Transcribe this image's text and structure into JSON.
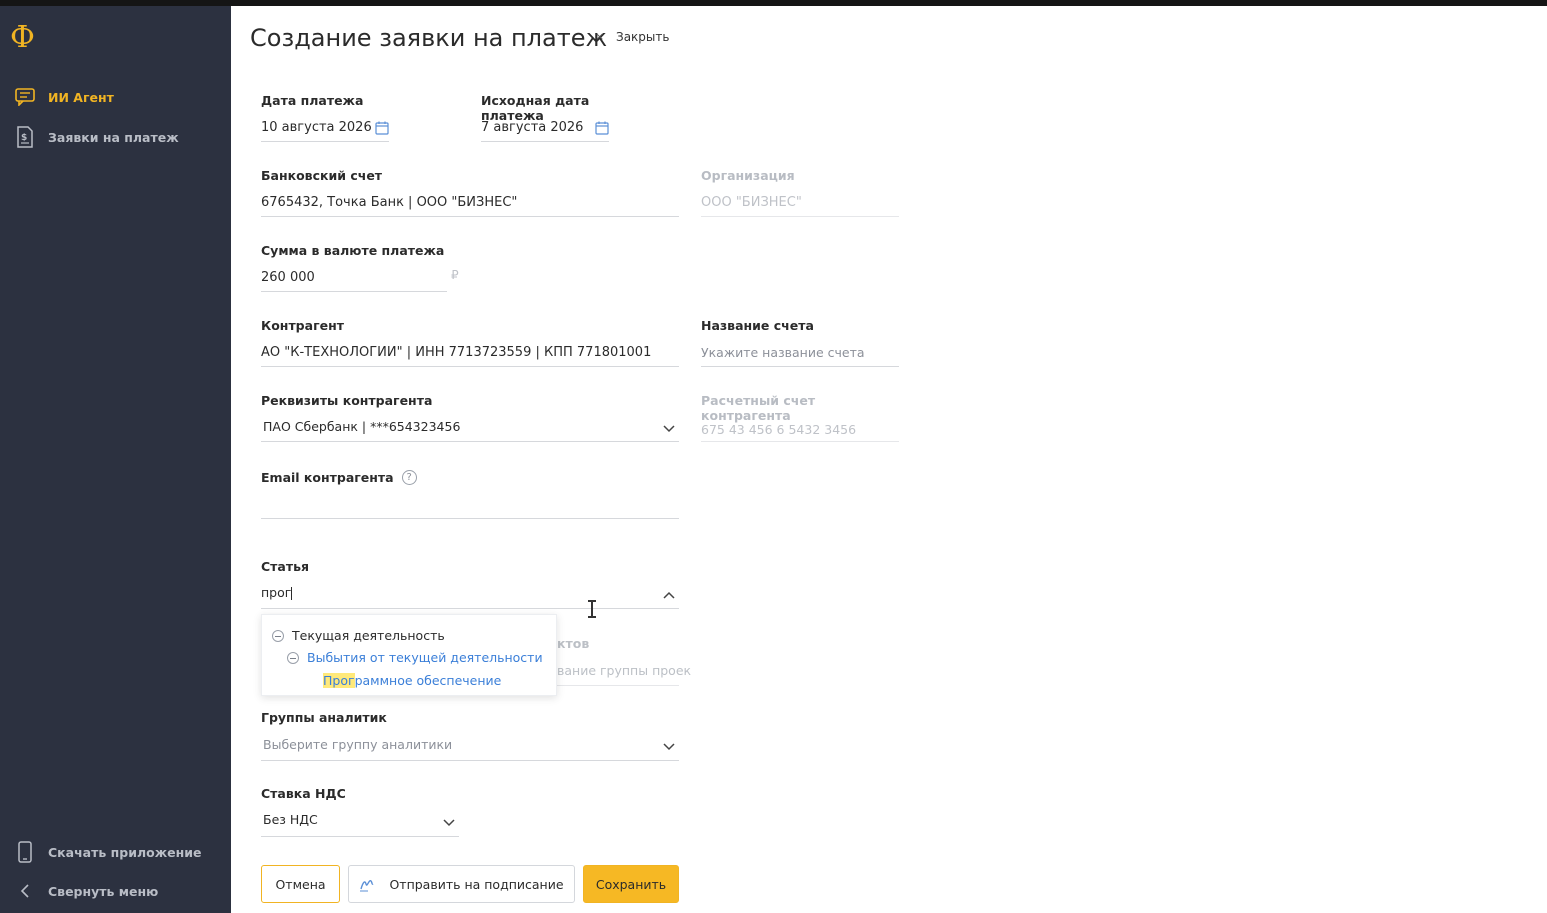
{
  "sidebar": {
    "logo": "Ф",
    "items": [
      {
        "label": "ИИ Агент",
        "icon": "chat-icon",
        "active": true
      },
      {
        "label": "Заявки на платеж",
        "icon": "document-dollar-icon",
        "active": false
      }
    ],
    "bottom": [
      {
        "label": "Скачать приложение",
        "icon": "phone-icon"
      },
      {
        "label": "Свернуть меню",
        "icon": "chevron-left-icon"
      }
    ]
  },
  "header": {
    "title": "Создание заявки на платеж",
    "close_x": "×",
    "close_label": "Закрыть"
  },
  "form": {
    "payment_date": {
      "label": "Дата платежа",
      "value": "10 августа 2026"
    },
    "original_date": {
      "label": "Исходная дата платежа",
      "value": "7 августа 2026"
    },
    "bank_account": {
      "label": "Банковский счет",
      "value": "6765432, Точка Банк | ООО \"БИЗНЕС\""
    },
    "organization": {
      "label": "Организация",
      "value": "ООО \"БИЗНЕС\""
    },
    "amount": {
      "label": "Сумма в валюте платежа",
      "value": "260 000",
      "currency": "₽"
    },
    "counterparty": {
      "label": "Контрагент",
      "value": "АО \"К-ТЕХНОЛОГИИ\" | ИНН 7713723559 | КПП 771801001"
    },
    "invoice_name": {
      "label": "Название счета",
      "placeholder": "Укажите название счета"
    },
    "counterparty_details": {
      "label": "Реквизиты контрагента",
      "value": "ПАО Сбербанк | ***654323456"
    },
    "counterparty_account": {
      "label": "Расчетный счет контрагента",
      "value": "675 43 456 6 5432 3456"
    },
    "email": {
      "label": "Email контрагента",
      "help": "?",
      "value": ""
    },
    "article": {
      "label": "Статья",
      "value": "прог"
    },
    "article_dropdown": {
      "group": "Текущая деятельность",
      "subgroup": "Выбытия от текущей деятельности",
      "item_highlight": "Прог",
      "item_rest": "раммное обеспечение"
    },
    "behind_dropdown": {
      "label_fragment": "ктов",
      "placeholder_fragment": "вание группы проек"
    },
    "analytics_groups": {
      "label": "Группы аналитик",
      "placeholder": "Выберите группу аналитики"
    },
    "vat_rate": {
      "label": "Ставка НДС",
      "value": "Без НДС"
    }
  },
  "actions": {
    "cancel": "Отмена",
    "send": "Отправить на подписание",
    "save": "Сохранить"
  },
  "colors": {
    "accent": "#f1b423",
    "sidebar_bg": "#2c3140",
    "link_blue": "#3b7fd8",
    "highlight": "#ffe97a"
  }
}
